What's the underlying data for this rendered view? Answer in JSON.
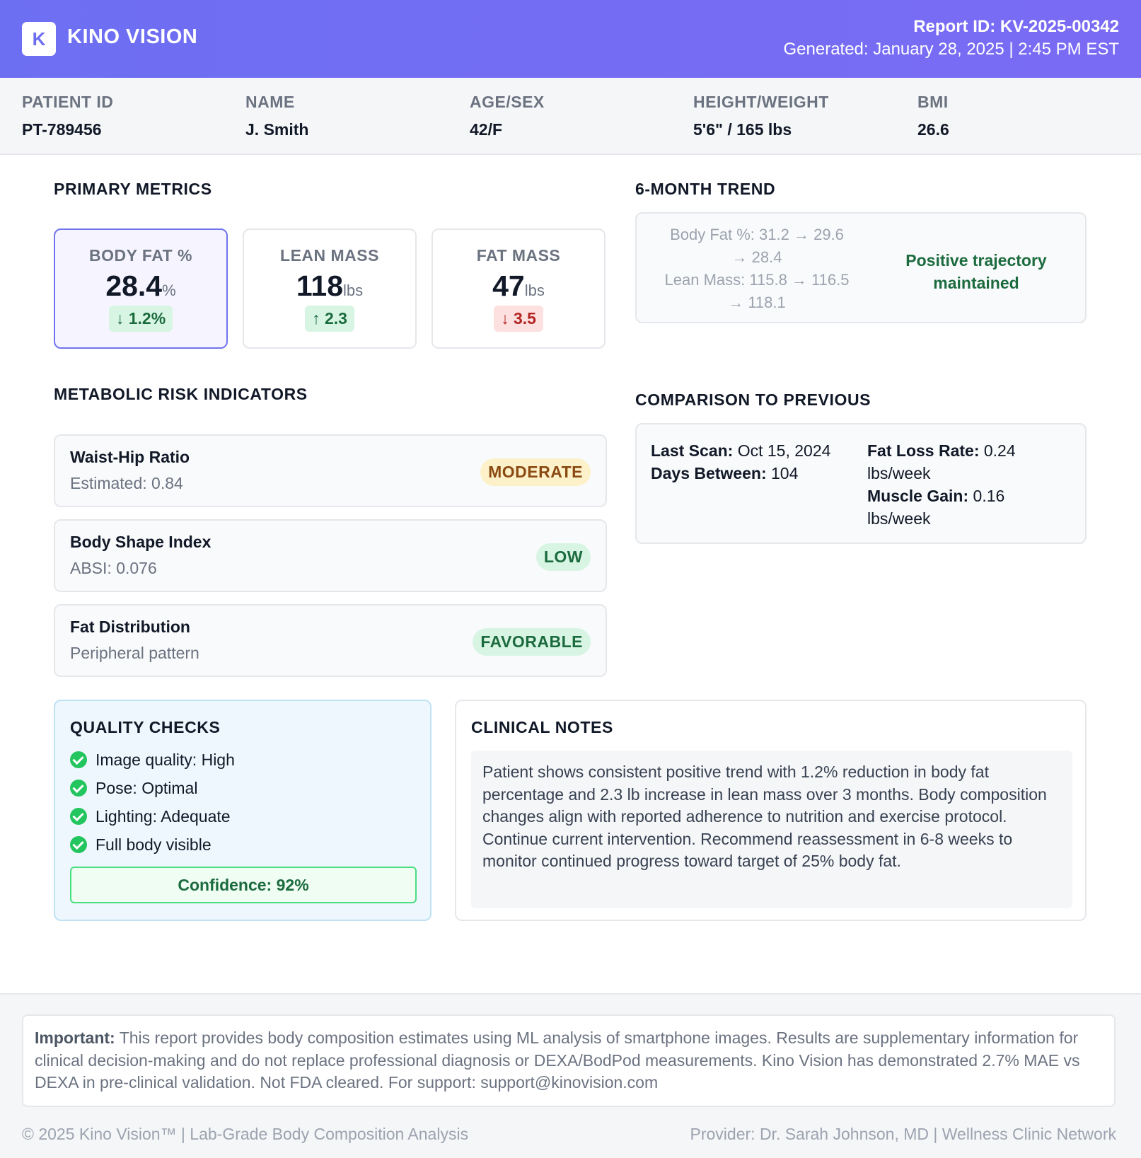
{
  "header": {
    "logo_letter": "K",
    "brand": "KINO VISION",
    "report_id": "Report ID: KV-2025-00342",
    "generated": "Generated: January 28, 2025 | 2:45 PM EST",
    "gradient_colors": [
      "#6d6ff2",
      "#7a6bf4"
    ]
  },
  "patient": {
    "fields": [
      {
        "label": "PATIENT ID",
        "value": "PT-789456"
      },
      {
        "label": "NAME",
        "value": "J. Smith"
      },
      {
        "label": "AGE/SEX",
        "value": "42/F"
      },
      {
        "label": "HEIGHT/WEIGHT",
        "value": "5'6\" / 165 lbs"
      },
      {
        "label": "BMI",
        "value": "26.6"
      }
    ]
  },
  "primary_metrics": {
    "title": "PRIMARY METRICS",
    "cards": [
      {
        "label": "BODY FAT %",
        "value": "28.4",
        "unit": "%",
        "change": "1.2%",
        "direction": "down",
        "status": "good"
      },
      {
        "label": "LEAN MASS",
        "value": "118",
        "unit": "lbs",
        "change": "2.3",
        "direction": "up",
        "status": "good"
      },
      {
        "label": "FAT MASS",
        "value": "47",
        "unit": "lbs",
        "change": "3.5",
        "direction": "down",
        "status": "bad"
      }
    ]
  },
  "trend": {
    "title": "6-MONTH TREND",
    "line1": "Body Fat %: 31.2 → 29.6",
    "line2": "→ 28.4",
    "line3": "Lean Mass: 115.8 → 116.5",
    "line4": "→ 118.1",
    "status_line1": "Positive trajectory",
    "status_line2": "maintained"
  },
  "risk": {
    "title": "METABOLIC RISK INDICATORS",
    "items": [
      {
        "name": "Waist-Hip Ratio",
        "sub": "Estimated: 0.84",
        "badge": "MODERATE"
      },
      {
        "name": "Body Shape Index",
        "sub": "ABSI: 0.076",
        "badge": "LOW"
      },
      {
        "name": "Fat Distribution",
        "sub": "Peripheral pattern",
        "badge": "FAVORABLE"
      }
    ]
  },
  "comparison": {
    "title": "COMPARISON TO PREVIOUS",
    "last_scan_label": "Last Scan:",
    "last_scan_value": "Oct 15, 2024",
    "days_label": "Days Between:",
    "days_value": "104",
    "fat_loss_label": "Fat Loss Rate:",
    "fat_loss_value": "0.24 lbs/week",
    "muscle_label": "Muscle Gain:",
    "muscle_value": "0.16 lbs/week"
  },
  "quality": {
    "title": "QUALITY CHECKS",
    "items": [
      "Image quality: High",
      "Pose: Optimal",
      "Lighting: Adequate",
      "Full body visible"
    ],
    "confidence": "Confidence: 92%"
  },
  "notes": {
    "title": "CLINICAL NOTES",
    "body": "Patient shows consistent positive trend with 1.2% reduction in body fat percentage and 2.3 lb increase in lean mass over 3 months. Body composition changes align with reported adherence to nutrition and exercise protocol. Continue current intervention. Recommend reassessment in 6-8 weeks to monitor continued progress toward target of 25% body fat."
  },
  "footer": {
    "disclaimer_label": "Important:",
    "disclaimer": "This report provides body composition estimates using ML analysis of smartphone images. Results are supplementary information for clinical decision-making and do not replace professional diagnosis or DEXA/BodPod measurements. Kino Vision has demonstrated 2.7% MAE vs DEXA in pre-clinical validation. Not FDA cleared. For support: support@kinovision.com",
    "copyright": "© 2025 Kino Vision™ | Lab-Grade Body Composition Analysis",
    "provider": "Provider: Dr. Sarah Johnson, MD | Wellness Clinic Network"
  }
}
